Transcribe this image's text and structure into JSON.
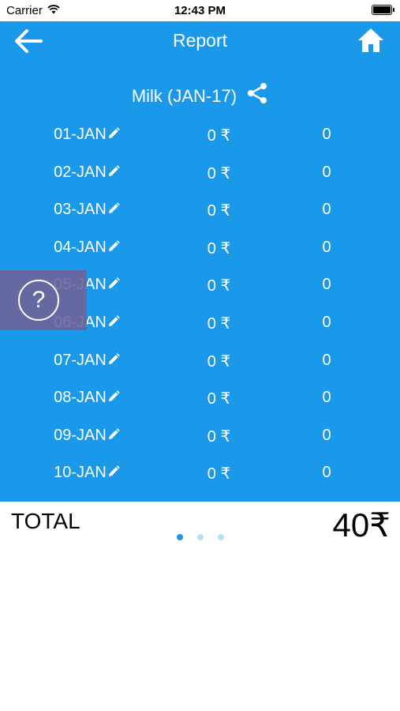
{
  "status_bar": {
    "carrier": "Carrier",
    "time": "12:43 PM"
  },
  "nav": {
    "title": "Report",
    "back_icon": "arrow-left-icon",
    "home_icon": "home-icon"
  },
  "report": {
    "heading": "Milk (JAN-17)",
    "share_icon": "share-icon",
    "rows": [
      {
        "date": "01-JAN",
        "amount": "0 ₹",
        "qty": "0"
      },
      {
        "date": "02-JAN",
        "amount": "0 ₹",
        "qty": "0"
      },
      {
        "date": "03-JAN",
        "amount": "0 ₹",
        "qty": "0"
      },
      {
        "date": "04-JAN",
        "amount": "0 ₹",
        "qty": "0"
      },
      {
        "date": "05-JAN",
        "amount": "0 ₹",
        "qty": "0"
      },
      {
        "date": "06-JAN",
        "amount": "0 ₹",
        "qty": "0"
      },
      {
        "date": "07-JAN",
        "amount": "0 ₹",
        "qty": "0"
      },
      {
        "date": "08-JAN",
        "amount": "0 ₹",
        "qty": "0"
      },
      {
        "date": "09-JAN",
        "amount": "0 ₹",
        "qty": "0"
      },
      {
        "date": "10-JAN",
        "amount": "0 ₹",
        "qty": "0"
      }
    ]
  },
  "help": {
    "symbol": "?"
  },
  "total": {
    "label": "TOTAL",
    "value": "40₹"
  },
  "pager": {
    "count": 3,
    "active_index": 0
  },
  "colors": {
    "panel": "#1a98ea",
    "dot_active": "#1a98ea",
    "dot_inactive": "#b8e0f6"
  }
}
